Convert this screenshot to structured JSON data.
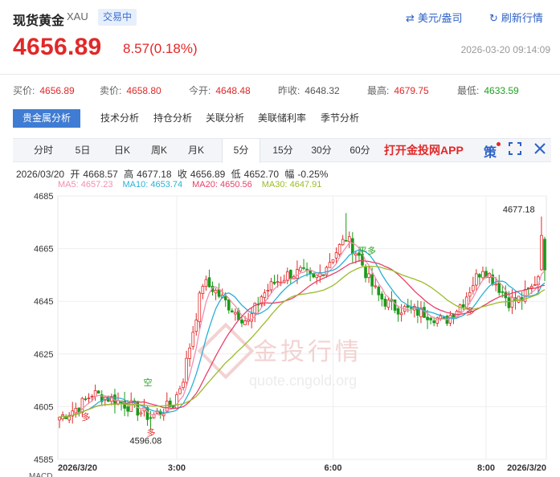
{
  "header": {
    "title": "现货黄金",
    "code": "XAU",
    "status": "交易中",
    "price": "4656.89",
    "change": "8.57(0.18%)",
    "currency_link": "美元/盎司",
    "refresh_link": "刷新行情",
    "datetime": "2026-03-20 09:14:09"
  },
  "quotes": [
    {
      "label": "买价:",
      "value": "4656.89",
      "color": "red"
    },
    {
      "label": "卖价:",
      "value": "4658.80",
      "color": "red"
    },
    {
      "label": "今开:",
      "value": "4648.48",
      "color": "red"
    },
    {
      "label": "昨收:",
      "value": "4648.32",
      "color": "gray"
    },
    {
      "label": "最高:",
      "value": "4679.75",
      "color": "red"
    },
    {
      "label": "最低:",
      "value": "4633.59",
      "color": "green"
    }
  ],
  "tabs": [
    "贵金属分析",
    "技术分析",
    "持仓分析",
    "关联分析",
    "美联储利率",
    "季节分析"
  ],
  "periods": [
    "分时",
    "5日",
    "日K",
    "周K",
    "月K",
    "5分",
    "15分",
    "30分",
    "60分"
  ],
  "active_period": "5分",
  "app_link": "打开金投网APP",
  "toolbar": {
    "ce_label": "策"
  },
  "candle_info": {
    "date": "2026/03/20",
    "open_label": "开",
    "open": "4668.57",
    "high_label": "高",
    "high": "4677.18",
    "close_label": "收",
    "close": "4656.89",
    "low_label": "低",
    "low": "4652.70",
    "amp_label": "幅",
    "amp": "-0.25%"
  },
  "ma_info": [
    {
      "label": "MA5:",
      "value": "4657.23",
      "color": "#f08fae"
    },
    {
      "label": "MA10:",
      "value": "4653.74",
      "color": "#2ab0d6"
    },
    {
      "label": "MA20:",
      "value": "4650.56",
      "color": "#e8416a"
    },
    {
      "label": "MA30:",
      "value": "4647.91",
      "color": "#9bbb2b"
    }
  ],
  "watermark": {
    "text": "金投行情",
    "url": "quote.cngold.org"
  },
  "chart_data": {
    "type": "candlestick",
    "y_ticks": [
      4685,
      4665,
      4645,
      4625,
      4605,
      4585
    ],
    "ylim": [
      4585,
      4685
    ],
    "x_tick_labels": [
      {
        "index": 0,
        "label": "2026/3/20"
      },
      {
        "index": 36,
        "label": "3:00"
      },
      {
        "index": 84,
        "label": "6:00"
      },
      {
        "index": 131,
        "label": "8:00"
      },
      {
        "index": 149,
        "label": "2026/3/20"
      }
    ],
    "annotations": [
      {
        "index": 148,
        "value": 4677.18,
        "text": "4677.18"
      },
      {
        "index": 28,
        "value": 4596.08,
        "text": "4596.08"
      }
    ],
    "signals": [
      {
        "index": 8,
        "value": 4600,
        "text": "多",
        "color": "#e12828"
      },
      {
        "index": 28,
        "value": 4594,
        "text": "多",
        "color": "#e12828"
      },
      {
        "index": 27,
        "value": 4613,
        "text": "空",
        "color": "#21a121"
      },
      {
        "index": 93,
        "value": 4663,
        "text": "平多",
        "color": "#21a121"
      },
      {
        "index": 126,
        "value": 4640,
        "text": "多",
        "color": "#e12828"
      }
    ],
    "series_labels": [
      "MA5",
      "MA10",
      "MA20",
      "MA30"
    ],
    "ma_colors": [
      "#f08fae",
      "#2ab0d6",
      "#e8416a",
      "#9bbb2b"
    ],
    "up_color": "#e12828",
    "down_color": "#1a9a1a",
    "close_keyframes": [
      [
        0,
        4601
      ],
      [
        6,
        4605
      ],
      [
        10,
        4610
      ],
      [
        16,
        4608
      ],
      [
        22,
        4605
      ],
      [
        28,
        4601
      ],
      [
        32,
        4604
      ],
      [
        35,
        4606
      ],
      [
        38,
        4616
      ],
      [
        41,
        4634
      ],
      [
        44,
        4652
      ],
      [
        47,
        4650
      ],
      [
        50,
        4646
      ],
      [
        54,
        4641
      ],
      [
        58,
        4637
      ],
      [
        62,
        4647
      ],
      [
        66,
        4652
      ],
      [
        70,
        4655
      ],
      [
        74,
        4656
      ],
      [
        78,
        4653
      ],
      [
        81,
        4657
      ],
      [
        85,
        4664
      ],
      [
        88,
        4669
      ],
      [
        92,
        4662
      ],
      [
        95,
        4653
      ],
      [
        98,
        4647
      ],
      [
        102,
        4643
      ],
      [
        106,
        4642
      ],
      [
        110,
        4641
      ],
      [
        114,
        4640
      ],
      [
        118,
        4637
      ],
      [
        121,
        4641
      ],
      [
        124,
        4645
      ],
      [
        127,
        4652
      ],
      [
        130,
        4658
      ],
      [
        134,
        4652
      ],
      [
        138,
        4645
      ],
      [
        142,
        4646
      ],
      [
        145,
        4650
      ],
      [
        147,
        4655
      ],
      [
        149,
        4657
      ]
    ]
  },
  "indicator_labels": "MACD"
}
